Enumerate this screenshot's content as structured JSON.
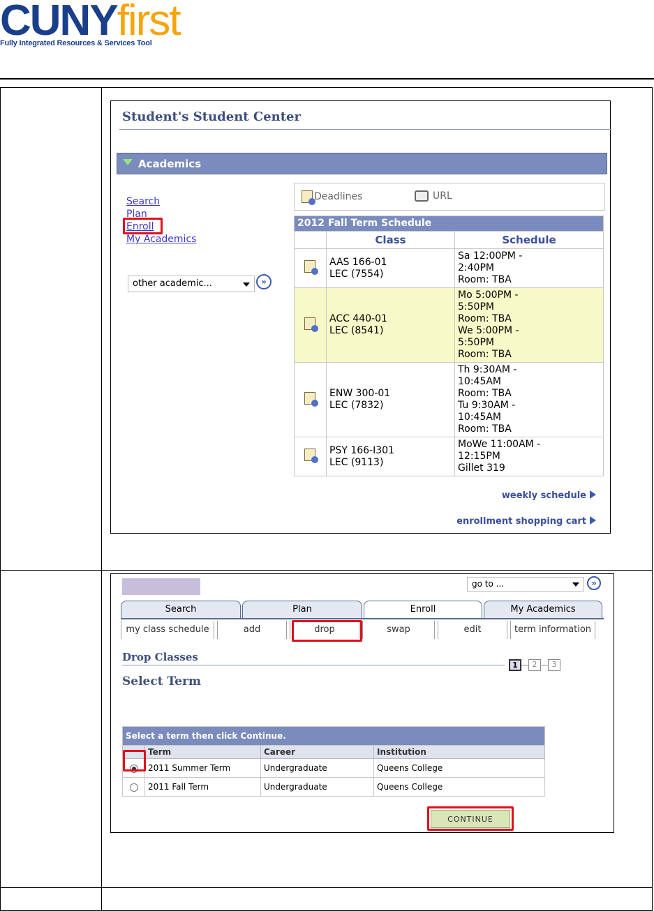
{
  "header": {
    "logo_cuny": "CUNY",
    "logo_first": "first",
    "logo_tagline": "Fully Integrated Resources & Services Tool"
  },
  "student_center": {
    "title": "Student's Student Center",
    "section_label": "Academics",
    "links": [
      "Search",
      "Plan",
      "Enroll",
      "My Academics"
    ],
    "other_select": "other academic...",
    "deadlines_label": "Deadlines",
    "url_label": "URL",
    "schedule_title": "2012 Fall Term Schedule",
    "col_class": "Class",
    "col_schedule": "Schedule",
    "rows": [
      {
        "class_1": "AAS 166-01",
        "class_2": "LEC (7554)",
        "schedule": [
          "Sa 12:00PM -",
          "2:40PM",
          "Room:  TBA"
        ],
        "highlight": false
      },
      {
        "class_1": "ACC 440-01",
        "class_2": "LEC (8541)",
        "schedule": [
          "Mo 5:00PM -",
          "5:50PM",
          "Room:  TBA",
          "We 5:00PM -",
          "5:50PM",
          "Room:  TBA"
        ],
        "highlight": true
      },
      {
        "class_1": "ENW 300-01",
        "class_2": "LEC (7832)",
        "schedule": [
          "Th 9:30AM -",
          "10:45AM",
          "Room:  TBA",
          "Tu 9:30AM -",
          "10:45AM",
          "Room:  TBA"
        ],
        "highlight": false
      },
      {
        "class_1": "PSY 166-I301",
        "class_2": "LEC (9113)",
        "schedule": [
          "MoWe 11:00AM -",
          "12:15PM",
          "Gillet 319"
        ],
        "highlight": false
      }
    ],
    "weekly_link": "weekly schedule",
    "cart_link": "enrollment shopping cart"
  },
  "drop_page": {
    "goto_select": "go to ...",
    "tabs": [
      "Search",
      "Plan",
      "Enroll",
      "My Academics"
    ],
    "subtabs": [
      "my class schedule",
      "add",
      "drop",
      "swap",
      "edit",
      "term information"
    ],
    "heading": "Drop Classes",
    "steps": [
      "1",
      "2",
      "3"
    ],
    "subheading": "Select Term",
    "table_caption": "Select a term then click Continue.",
    "columns": [
      "Term",
      "Career",
      "Institution"
    ],
    "terms": [
      {
        "term": "2011 Summer Term",
        "career": "Undergraduate",
        "institution": "Queens College",
        "selected": true
      },
      {
        "term": "2011 Fall Term",
        "career": "Undergraduate",
        "institution": "Queens College",
        "selected": false
      }
    ],
    "continue_label": "CONTINUE"
  }
}
